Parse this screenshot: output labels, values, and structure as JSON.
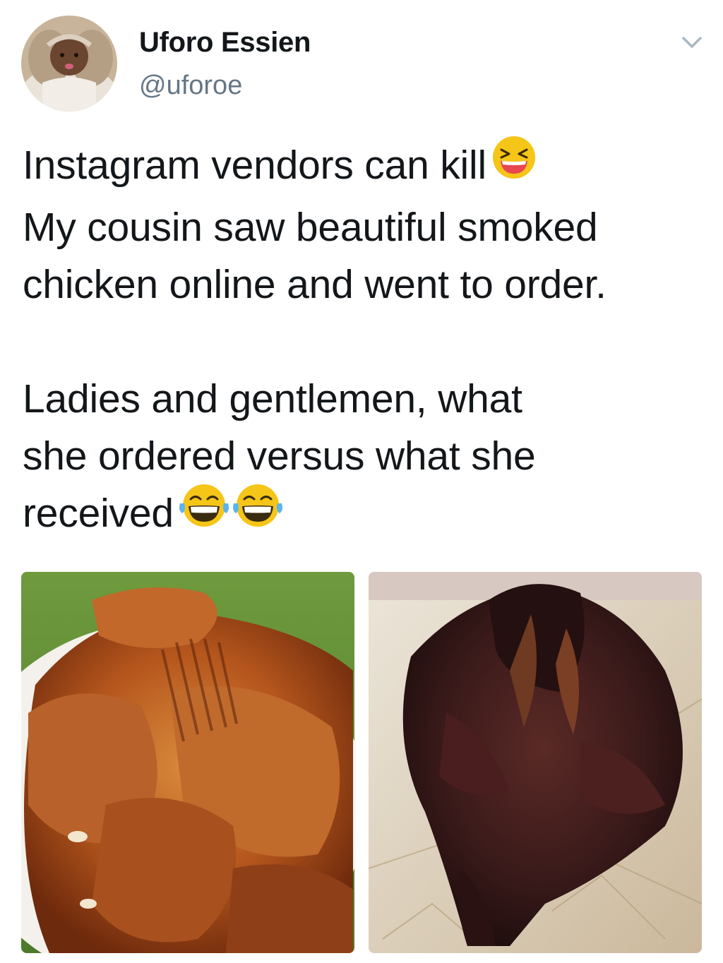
{
  "tweet": {
    "author": {
      "display_name": "Uforo Essien",
      "handle": "@uforoe"
    },
    "text": {
      "line1": "Instagram vendors can kill",
      "line2": "My cousin saw beautiful smoked",
      "line3": "chicken online and went to order.",
      "line4": "Ladies and gentlemen, what",
      "line5": "she ordered versus what she",
      "line6": "received"
    },
    "emojis": [
      "grinning-squinting-face",
      "face-with-tears-of-joy",
      "face-with-tears-of-joy"
    ],
    "colors": {
      "name": "#14171a",
      "handle": "#657786",
      "emoji": "#f5c518"
    }
  }
}
